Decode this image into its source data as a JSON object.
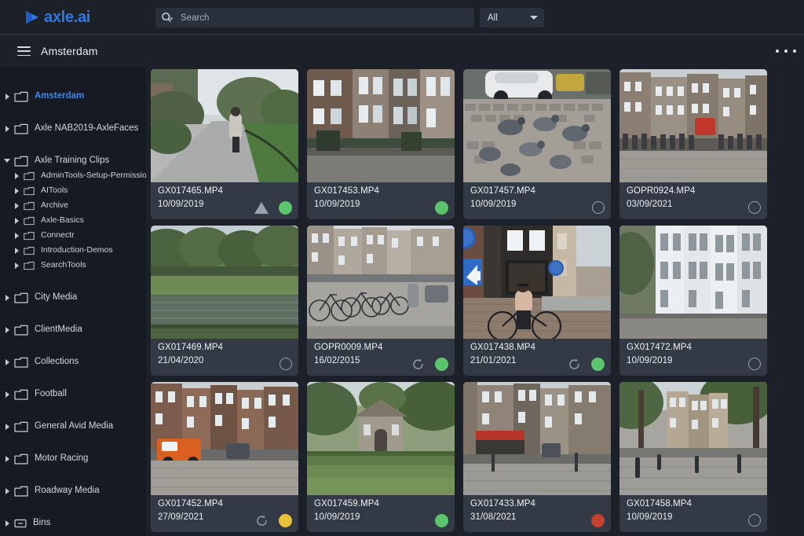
{
  "app": {
    "brand": "axle.ai",
    "logo_color": "#2f7ae5"
  },
  "topbar": {
    "search": {
      "placeholder": "Search",
      "value": "",
      "icon": "search-icon"
    },
    "filter": {
      "selected": "All",
      "options": [
        "All"
      ]
    }
  },
  "crumbbar": {
    "menu_icon": "hamburger-icon",
    "title": "Amsterdam",
    "overflow_icon": "kebab-icon"
  },
  "sidebar": {
    "items": [
      {
        "label": "Amsterdam",
        "level": 0,
        "expanded": false,
        "active": true
      },
      {
        "label": "Axle NAB2019-AxleFaces",
        "level": 0,
        "expanded": false,
        "active": false
      },
      {
        "label": "Axle Training Clips",
        "level": 0,
        "expanded": true,
        "active": false
      },
      {
        "label": "AdminTools-Setup-Permissions",
        "level": 1,
        "expanded": false,
        "active": false
      },
      {
        "label": "AITools",
        "level": 1,
        "expanded": false,
        "active": false
      },
      {
        "label": "Archive",
        "level": 1,
        "expanded": false,
        "active": false
      },
      {
        "label": "Axle-Basics",
        "level": 1,
        "expanded": false,
        "active": false
      },
      {
        "label": "Connectr",
        "level": 1,
        "expanded": false,
        "active": false
      },
      {
        "label": "Introduction-Demos",
        "level": 1,
        "expanded": false,
        "active": false
      },
      {
        "label": "SearchTools",
        "level": 1,
        "expanded": false,
        "active": false
      },
      {
        "label": "City Media",
        "level": 0,
        "expanded": false,
        "active": false
      },
      {
        "label": "ClientMedia",
        "level": 0,
        "expanded": false,
        "active": false
      },
      {
        "label": "Collections",
        "level": 0,
        "expanded": false,
        "active": false
      },
      {
        "label": "Football",
        "level": 0,
        "expanded": false,
        "active": false
      },
      {
        "label": "General Avid Media",
        "level": 0,
        "expanded": false,
        "active": false
      },
      {
        "label": "Motor Racing",
        "level": 0,
        "expanded": false,
        "active": false
      },
      {
        "label": "Roadway Media",
        "level": 0,
        "expanded": false,
        "active": false
      },
      {
        "label": "Bins",
        "level": 0,
        "expanded": false,
        "active": false,
        "icon": "bins-icon"
      }
    ]
  },
  "status_colors": {
    "green": "#5cc46c",
    "yellow": "#e8c13c",
    "red": "#c4402f",
    "neutral": "#9aa2ae"
  },
  "grid": {
    "cards": [
      {
        "filename": "GX017465.MP4",
        "date": "10/09/2019",
        "badges": [
          "triangle",
          "green"
        ],
        "scene": "park-path-walker"
      },
      {
        "filename": "GX017453.MP4",
        "date": "10/09/2019",
        "badges": [
          "green"
        ],
        "scene": "canal-houses-street"
      },
      {
        "filename": "GX017457.MP4",
        "date": "10/09/2019",
        "badges": [
          "empty"
        ],
        "scene": "pigeons-cobblestone-car"
      },
      {
        "filename": "GOPR0924.MP4",
        "date": "03/09/2021",
        "badges": [
          "empty"
        ],
        "scene": "dam-square-crowd"
      },
      {
        "filename": "GX017469.MP4",
        "date": "21/04/2020",
        "badges": [
          "empty"
        ],
        "scene": "park-pond-trees"
      },
      {
        "filename": "GOPR0009.MP4",
        "date": "16/02/2015",
        "badges": [
          "sync",
          "green"
        ],
        "scene": "bikes-parked-street"
      },
      {
        "filename": "GX017438.MP4",
        "date": "21/01/2021",
        "badges": [
          "sync",
          "green"
        ],
        "scene": "cyclist-corner-shop"
      },
      {
        "filename": "GX017472.MP4",
        "date": "10/09/2019",
        "badges": [
          "empty"
        ],
        "scene": "white-canal-houses"
      },
      {
        "filename": "GX017452.MP4",
        "date": "27/09/2021",
        "badges": [
          "sync",
          "yellow"
        ],
        "scene": "brick-buildings-orange-van"
      },
      {
        "filename": "GX017459.MP4",
        "date": "10/09/2019",
        "badges": [
          "green"
        ],
        "scene": "green-square-pavilion"
      },
      {
        "filename": "GX017433.MP4",
        "date": "31/08/2021",
        "badges": [
          "red"
        ],
        "scene": "red-awning-corner-street"
      },
      {
        "filename": "GX017458.MP4",
        "date": "10/09/2019",
        "badges": [
          "empty"
        ],
        "scene": "tree-lined-road-bollards"
      }
    ]
  }
}
